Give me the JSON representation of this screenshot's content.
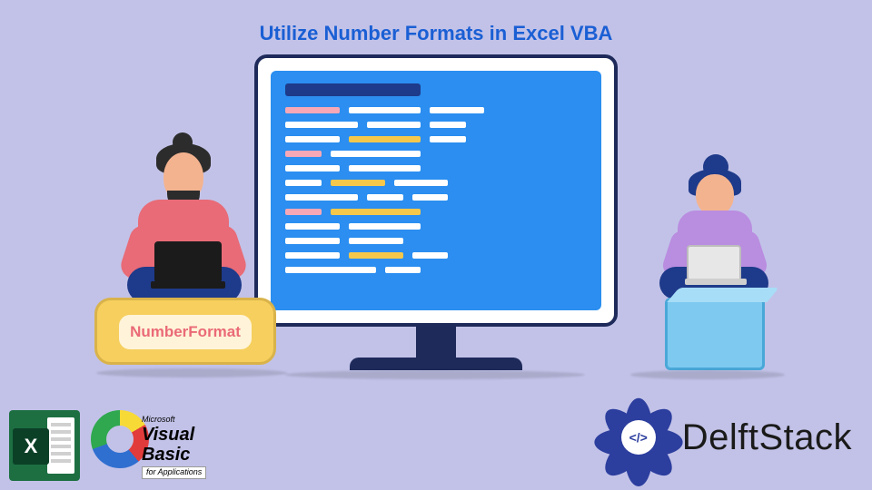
{
  "title": "Utilize Number Formats in Excel VBA",
  "label_box": "NumberFormat",
  "logos": {
    "excel_letter": "X",
    "vb_line1": "Microsoft",
    "vb_line2": "Visual Basic",
    "vb_line3": "for Applications"
  },
  "brand": {
    "name": "DelftStack",
    "glyph": "</>"
  }
}
